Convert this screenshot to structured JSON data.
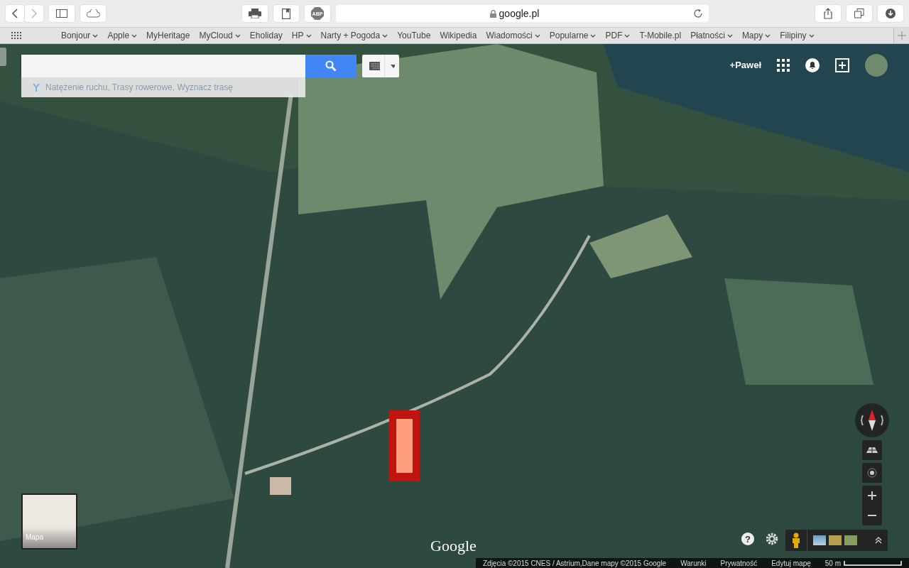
{
  "toolbar": {
    "address": "google.pl",
    "adblock": "ABP"
  },
  "bookmarks": [
    {
      "label": "Bonjour",
      "menu": true
    },
    {
      "label": "Apple",
      "menu": true
    },
    {
      "label": "MyHeritage",
      "menu": false
    },
    {
      "label": "MyCloud",
      "menu": true
    },
    {
      "label": "Eholiday",
      "menu": false
    },
    {
      "label": "HP",
      "menu": true
    },
    {
      "label": "Narty + Pogoda",
      "menu": true
    },
    {
      "label": "YouTube",
      "menu": false
    },
    {
      "label": "Wikipedia",
      "menu": false
    },
    {
      "label": "Wiadomości",
      "menu": true
    },
    {
      "label": "Popularne",
      "menu": true
    },
    {
      "label": "PDF",
      "menu": true
    },
    {
      "label": "T-Mobile.pl",
      "menu": false
    },
    {
      "label": "Płatności",
      "menu": true
    },
    {
      "label": "Mapy",
      "menu": true
    },
    {
      "label": "Filipiny",
      "menu": true
    }
  ],
  "map": {
    "suggestion": "Natężenie ruchu, Trasy rowerowe, Wyznacz trasę",
    "user": "+Paweł",
    "minimap_label": "Mapa",
    "logo": "Google",
    "scale": "50 m",
    "help": "?",
    "footer": [
      "Zdjęcia ©2015 CNES / Astrium,Dane mapy ©2015 Google",
      "Warunki",
      "Prywatność",
      "Edytuj mapę"
    ]
  }
}
